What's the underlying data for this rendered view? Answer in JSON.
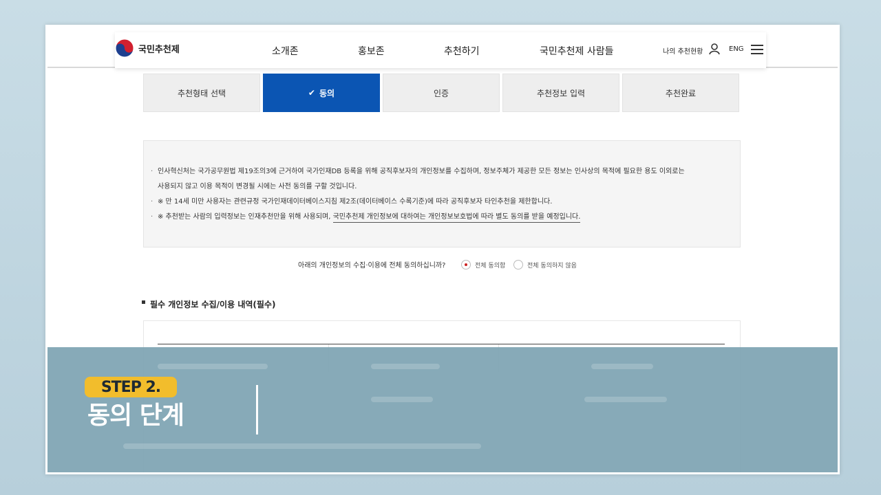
{
  "header": {
    "logo_text": "국민추천제",
    "nav": [
      "소개존",
      "홍보존",
      "추천하기",
      "국민추천제 사람들"
    ],
    "my_status": "나의 추천현황",
    "lang": "ENG"
  },
  "steps": [
    {
      "label": "추천형태 선택",
      "active": false
    },
    {
      "label": "동의",
      "active": true
    },
    {
      "label": "인증",
      "active": false
    },
    {
      "label": "추천정보 입력",
      "active": false
    },
    {
      "label": "추천완료",
      "active": false
    }
  ],
  "notice": {
    "line1": "인사혁신처는 국가공무원법 제19조의3에 근거하여 국가인재DB 등록을 위해 공직후보자의 개인정보를 수집하며, 정보주체가 제공한 모든 정보는 인사상의 목적에 필요한 용도 이외로는",
    "line1b": "사용되지 않고 이용 목적이 변경될 시에는 사전 동의를 구할 것입니다.",
    "line2": "※ 만 14세 미만 사용자는 관련규정 국가인재데이터베이스지침 제2조(데이터베이스 수록기준)에 따라 공직후보자 타인추천을 제한합니다.",
    "line3_a": "※ 추천받는 사람의 입력정보는 인재추천만을 위해 사용되며, ",
    "line3_b": "국민추천제 개인정보에 대하여는 개인정보보호법에 따라 별도 동의를 받을 예정입니다."
  },
  "agree": {
    "question": "아래의 개인정보의 수집·이용에 전체 동의하십니까?",
    "yes": "전체 동의함",
    "no": "전체 동의하지 않음",
    "selected": "yes"
  },
  "section_title": "필수 개인정보 수집/이용 내역(필수)",
  "caption": {
    "badge": "STEP 2.",
    "title": "동의 단계"
  },
  "colors": {
    "accent": "#0b55b3",
    "badge": "#f2bd2c",
    "overlay": "#7da3b2"
  }
}
